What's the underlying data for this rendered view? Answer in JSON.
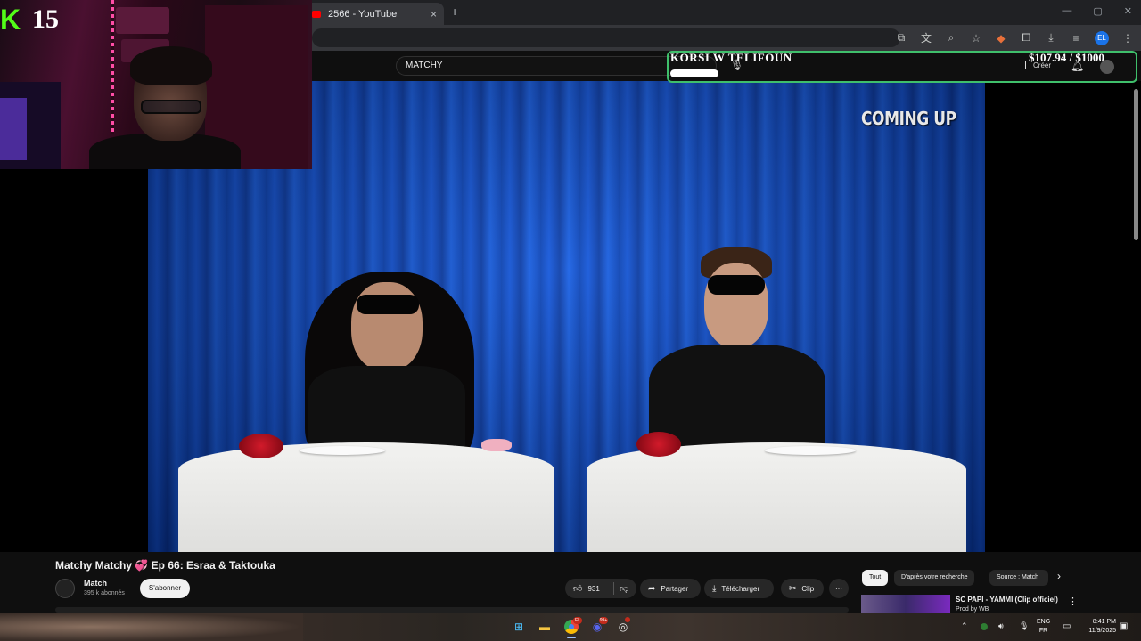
{
  "browser": {
    "tab_title": "2566 - YouTube",
    "tab_close": "×",
    "new_tab": "+",
    "window_controls": [
      "—",
      "▢",
      "✕"
    ],
    "profile_initials": "EL"
  },
  "youtube_header": {
    "search_value": "MATCHY",
    "create_label": "Créer"
  },
  "stream_overlay": {
    "goal_title": "KORSI W TELIFOUN",
    "goal_amount": "$107.94  / $1000",
    "goal_progress": 0.108,
    "viewer_count": "15",
    "platform_logo": "K",
    "accent_color": "#53fc18"
  },
  "video": {
    "overlay_text": "COMING UP"
  },
  "video_info": {
    "title": "Matchy Matchy",
    "title_emoji": "💞",
    "title_rest": "Ep 66: Esraa & Taktouka",
    "channel_name": "Match",
    "subscriber_count": "395 k abonnés",
    "subscribe_label": "S'abonner",
    "like_count": "931",
    "share_label": "Partager",
    "download_label": "Télécharger",
    "clip_label": "Clip",
    "more_label": "···"
  },
  "recommendations": {
    "chips": [
      "Tout",
      "D'après votre recherche",
      "Source : Match"
    ],
    "next_chip": "›",
    "first_item_title": "SC PAPI - YAMMI (Clip officiel)",
    "first_item_subtitle": "Prod by WB"
  },
  "taskbar": {
    "start_icon": "windows-start-icon",
    "apps": [
      "file-explorer-icon",
      "chrome-icon",
      "discord-icon",
      "obs-icon"
    ],
    "chrome_badge": "EL",
    "discord_badge": "99+",
    "language_top": "ENG",
    "language_bottom": "FR",
    "time": "8:41 PM",
    "date": "11/9/2025"
  }
}
